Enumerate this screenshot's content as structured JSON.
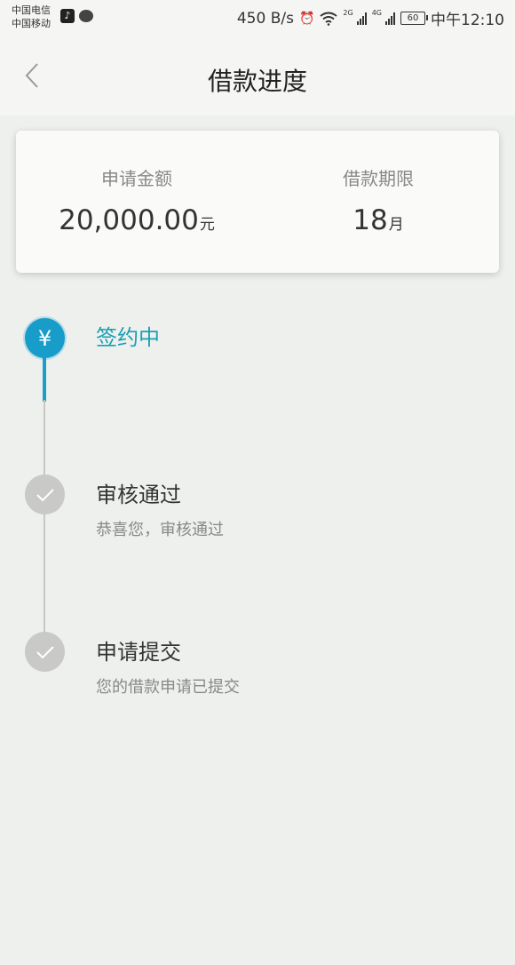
{
  "status_bar": {
    "carrier_1": "中国电信",
    "carrier_2": "中国移动",
    "speed": "450 B/s",
    "battery": "60",
    "time": "中午12:10",
    "net_1": "2G",
    "net_2": "4G"
  },
  "header": {
    "title": "借款进度"
  },
  "summary": {
    "amount_label": "申请金额",
    "amount_value": "20,000.00",
    "amount_unit": "元",
    "term_label": "借款期限",
    "term_value": "18",
    "term_unit": "月"
  },
  "steps": [
    {
      "title": "签约中",
      "desc": "",
      "status": "active",
      "icon": "yen-icon"
    },
    {
      "title": "审核通过",
      "desc": "恭喜您，审核通过",
      "status": "done",
      "icon": "check-icon"
    },
    {
      "title": "申请提交",
      "desc": "您的借款申请已提交",
      "status": "done",
      "icon": "check-icon"
    }
  ],
  "colors": {
    "accent": "#189dca",
    "active_text": "#1a9fb4",
    "inactive_dot": "#c9cac8",
    "background": "#eef0ed"
  }
}
